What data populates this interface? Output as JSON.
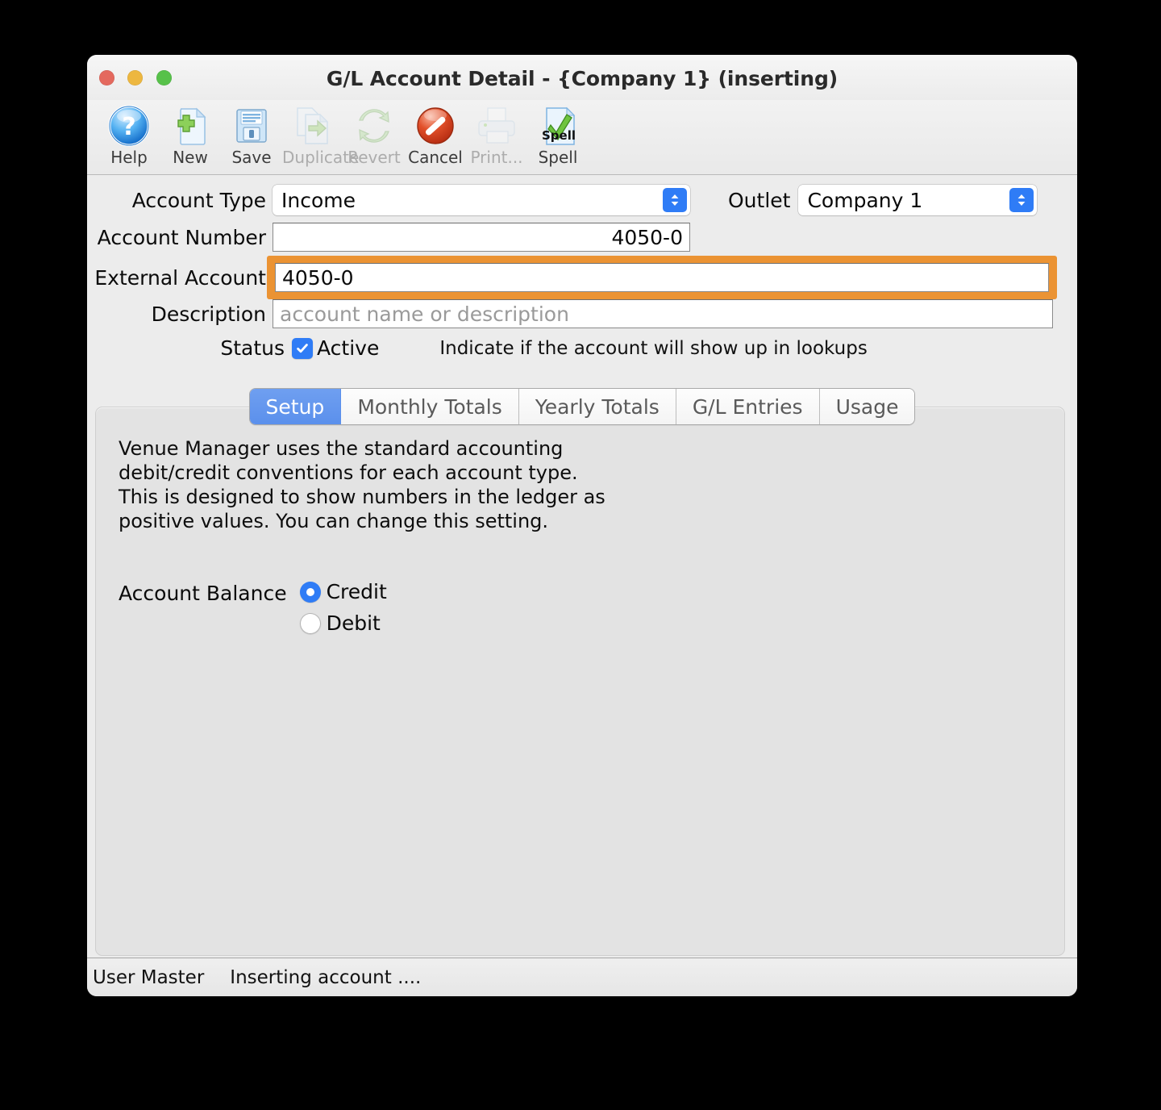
{
  "window": {
    "title": "G/L Account Detail -  {Company 1} (inserting)",
    "traffic": {
      "close": "close-button",
      "minimize": "minimize-button",
      "zoom": "zoom-button"
    }
  },
  "toolbar": {
    "items": [
      {
        "label": "Help",
        "icon": "help-icon",
        "enabled": true
      },
      {
        "label": "New",
        "icon": "new-icon",
        "enabled": true
      },
      {
        "label": "Save",
        "icon": "save-icon",
        "enabled": true
      },
      {
        "label": "Duplicate",
        "icon": "duplicate-icon",
        "enabled": false
      },
      {
        "label": "Revert",
        "icon": "revert-icon",
        "enabled": false
      },
      {
        "label": "Cancel",
        "icon": "cancel-icon",
        "enabled": true
      },
      {
        "label": "Print...",
        "icon": "print-icon",
        "enabled": false
      },
      {
        "label": "Spell",
        "icon": "spell-icon",
        "enabled": true
      }
    ]
  },
  "form": {
    "account_type": {
      "label": "Account Type",
      "value": "Income"
    },
    "outlet": {
      "label": "Outlet",
      "value": "Company 1"
    },
    "account_number": {
      "label": "Account Number",
      "value": "4050-0"
    },
    "external_account": {
      "label": "External Account",
      "value": "4050-0",
      "focused": true
    },
    "description": {
      "label": "Description",
      "value": "",
      "placeholder": "account name or description"
    },
    "status": {
      "label": "Status",
      "checkbox_label": "Active",
      "checked": true,
      "hint": "Indicate if the account will show up in lookups"
    }
  },
  "tabs": [
    {
      "label": "Setup",
      "active": true
    },
    {
      "label": "Monthly Totals",
      "active": false
    },
    {
      "label": "Yearly Totals",
      "active": false
    },
    {
      "label": "G/L Entries",
      "active": false
    },
    {
      "label": "Usage",
      "active": false
    }
  ],
  "setup_panel": {
    "blurb": "Venue Manager uses the standard accounting\ndebit/credit conventions for each account type.\nThis is designed to show numbers in the ledger as\npositive values.   You can change this setting.",
    "account_balance": {
      "label": "Account Balance",
      "options": [
        {
          "label": "Credit",
          "selected": true
        },
        {
          "label": "Debit",
          "selected": false
        }
      ]
    }
  },
  "statusbar": {
    "user": "User Master",
    "message": "Inserting account ...."
  },
  "colors": {
    "accent_blue": "#2f7cf6",
    "focus_orange": "#eb9333",
    "tab_active_blue": "#5b90ec",
    "window_bg": "#ececec",
    "panel_bg": "#e3e3e3"
  }
}
